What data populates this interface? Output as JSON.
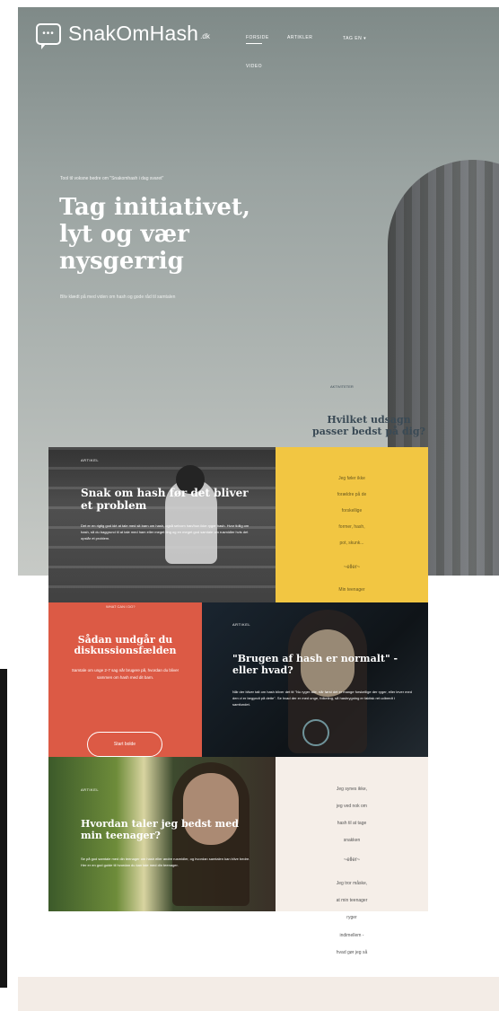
{
  "header": {
    "logo_icon": "•••",
    "logo_text": "SnakOmHash",
    "logo_tld": ".dk",
    "nav": [
      "FORSIDE",
      "ARTIKLER",
      "TAG EN",
      "VIDEO"
    ]
  },
  "hero": {
    "kicker": "Tool til voksne bedre om \"Snakomhash i dag svaret\"",
    "title": "Tag initiativet, lyt og vær nysgerrig",
    "subtitle": "Bliv klædt på med viden om hash og gode råd til samtalen",
    "scroll_label": "AKTIVITETER",
    "which_title": "Hvilket udsagn passer bedst på dig?"
  },
  "tiles": {
    "stairs": {
      "tag": "ARTIKEL",
      "title": "Snak om hash før det bliver et problem",
      "body": "Det er en rigtig god idé at tale med sit barn om hash, også selvom han/hun ikke ryger hash. Hvor tidlig om hash, så du baggrund til at tale med ham eller meget ting og en meget god samtale om rusmidler hvis det opstår et problem."
    },
    "yellow": {
      "lines": [
        "Jeg føler ikke",
        "forældre på de",
        "forskellige",
        "former, hash,",
        "pot, skunk..."
      ],
      "or": "~eller~",
      "last": "Min teenager"
    },
    "red": {
      "what_label": "WHAT CAN I DO?",
      "title": "Sådan undgår du diskussionsfælden",
      "body": "Samtale om unge 2-7 sag når brugere på, hvordan du bliver sammen om hash med dit barn.",
      "button": "Start bolde"
    },
    "dark": {
      "tag": "ARTIKEL",
      "title": "\"Brugen af hash er normalt\" - eller hvad?",
      "body": "Når der bliver talt om hash bliver det tit \"Nu ryger alle, når først det er mange forskellige der ryger, eller lever med den vi er begyndt på dette\". Se hvad der er med unge, folkeling, så hashrygning er faktisk ret udbredt i samfundet."
    },
    "green": {
      "tag": "ARTIKEL",
      "title": "Hvordan taler jeg bedst med min teenager?",
      "body": "Se på god samtale med din teenager om hash eller andre rusmidler, og hvordan samtalen kan blive bedre. Her er en god guide til hvordan du kan tale med din teenager."
    },
    "cream": {
      "lines_top": [
        "Jeg synes ikke,",
        "jeg ved nok om",
        "hash til at tage",
        "snakken"
      ],
      "or": "~eller~",
      "lines_bottom": [
        "Jeg tror måske,",
        "at min teenager",
        "ryger",
        "indimellem -",
        "hvad gør jeg så"
      ]
    }
  }
}
